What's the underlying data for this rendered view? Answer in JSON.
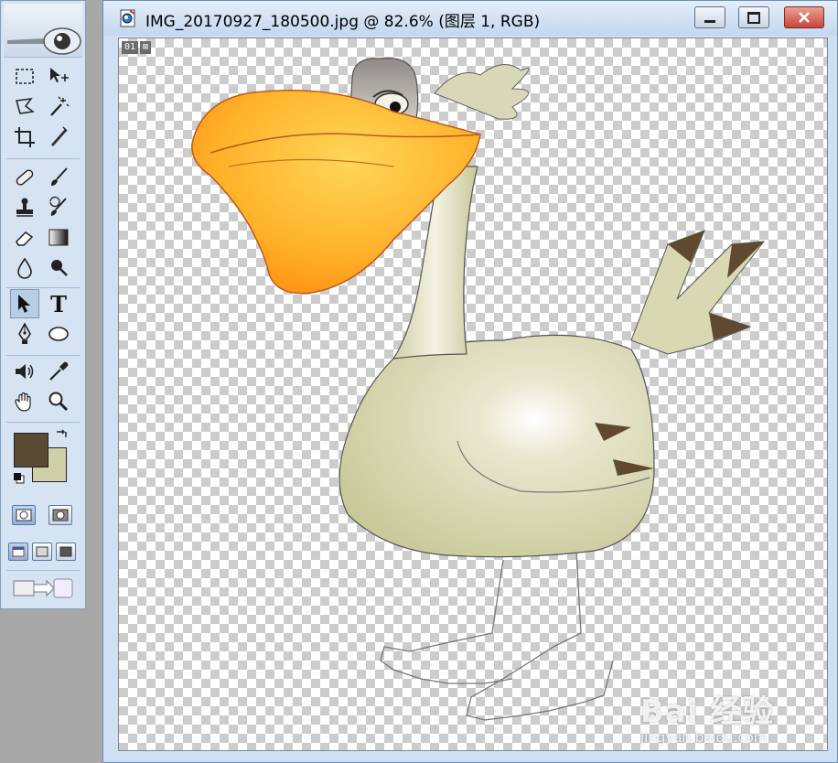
{
  "document": {
    "title": "IMG_20170927_180500.jpg @ 82.6% (图层 1, RGB)",
    "layer_badge": [
      "01",
      "⊠"
    ]
  },
  "window_controls": {
    "minimize": "minimize",
    "maximize": "maximize",
    "close": "close"
  },
  "toolbox": {
    "tools": [
      "rectangular-marquee",
      "move",
      "lasso",
      "magic-wand",
      "crop",
      "slice",
      "healing-brush",
      "brush",
      "clone-stamp",
      "history-brush",
      "eraser",
      "gradient",
      "blur",
      "dodge",
      "path-selection",
      "type",
      "pen",
      "ellipse",
      "notes",
      "eyedropper",
      "hand",
      "zoom"
    ],
    "active_tool": "path-selection",
    "type_tool_glyph": "T"
  },
  "colors": {
    "foreground": "#5b4a33",
    "background": "#cfcfa8",
    "accent_close": "#c9453a",
    "beak": "#ffa21c"
  },
  "watermark": {
    "brand": "Bai 经验",
    "url": "jingyan.baidu.com"
  }
}
